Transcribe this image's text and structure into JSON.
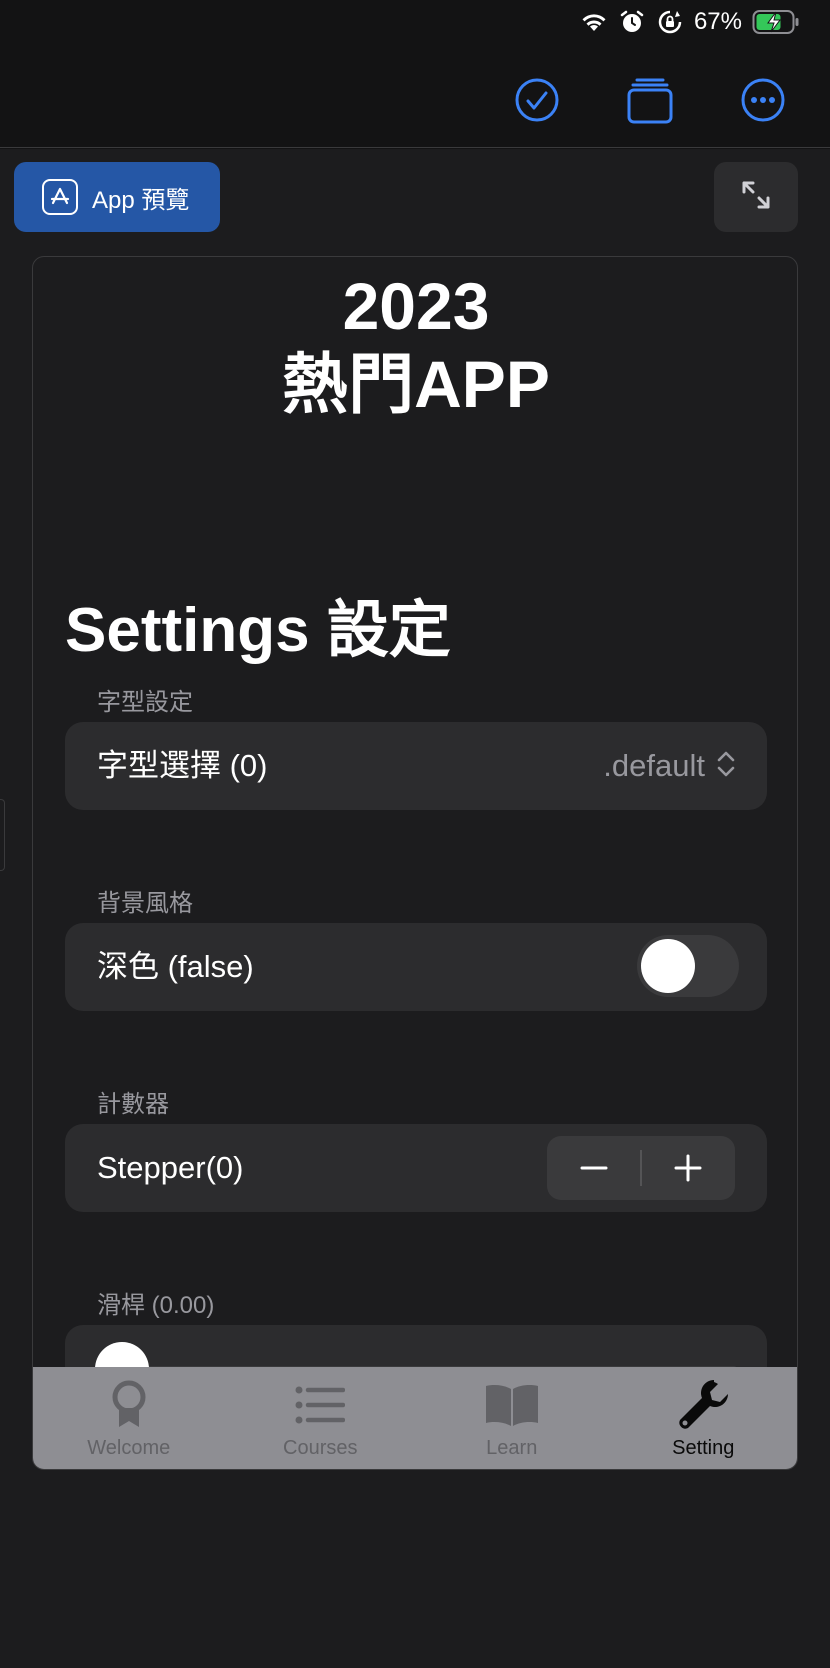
{
  "status_bar": {
    "battery_percent": "67%",
    "icons": [
      "wifi-icon",
      "alarm-icon",
      "orientation-lock-icon",
      "battery-charging-icon"
    ]
  },
  "toolbar": {
    "buttons": [
      "checkmark-circle-icon",
      "stack-icon",
      "more-icon"
    ],
    "accent_color": "#3b82f6"
  },
  "preview_button": {
    "label": "App 預覽"
  },
  "hero": {
    "line1": "2023",
    "line2": "熱門APP"
  },
  "page_title": "Settings 設定",
  "sections": {
    "font": {
      "header": "字型設定",
      "label": "字型選擇 (0)",
      "value": ".default"
    },
    "background": {
      "header": "背景風格",
      "label": "深色 (false)",
      "toggle_on": false
    },
    "counter": {
      "header": "計數器",
      "label": "Stepper(0)",
      "minus": "−",
      "plus": "+"
    },
    "slider": {
      "header": "滑桿 (0.00)",
      "value": 0.0
    }
  },
  "tab_bar": {
    "tabs": [
      {
        "label": "Welcome",
        "icon": "award-icon"
      },
      {
        "label": "Courses",
        "icon": "list-icon"
      },
      {
        "label": "Learn",
        "icon": "book-icon"
      },
      {
        "label": "Setting",
        "icon": "wrench-icon"
      }
    ],
    "active": "Setting"
  }
}
